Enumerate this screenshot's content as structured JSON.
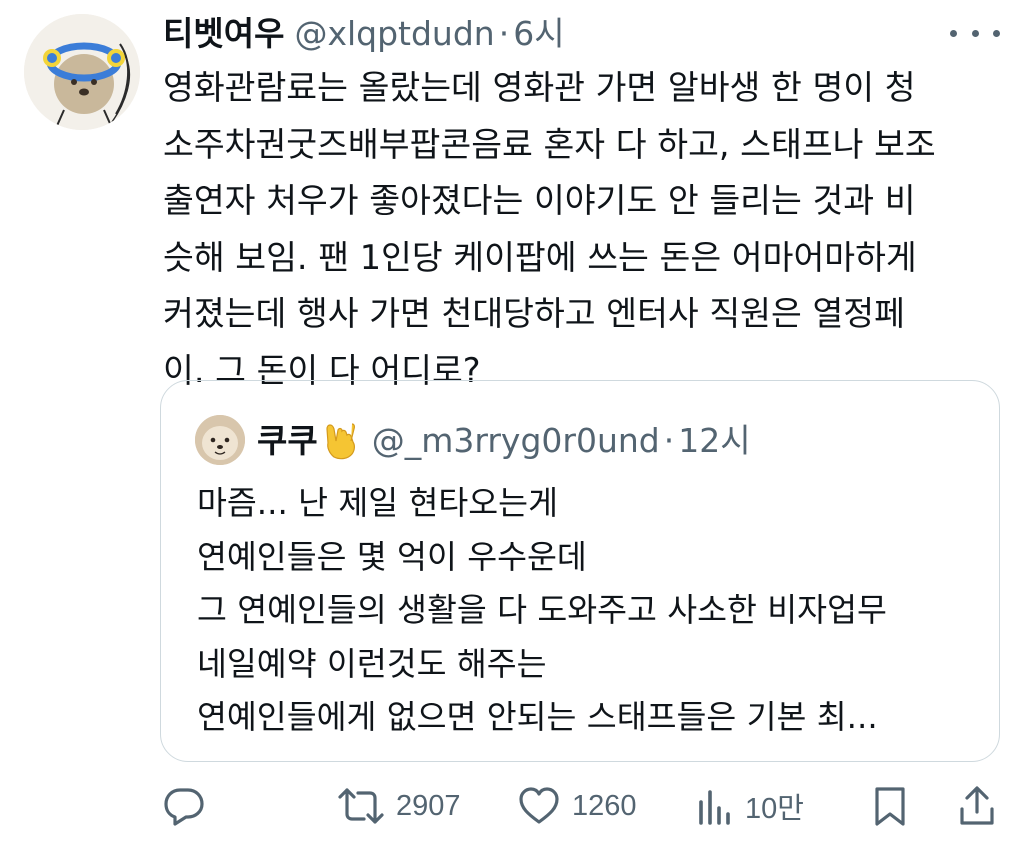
{
  "tweet": {
    "author_name": "티벳여우",
    "author_handle": "@xlqptdudn",
    "separator": "·",
    "time": "6시",
    "lines": [
      "영화관람료는 올랐는데 영화관 가면 알바생 한 명이 청",
      "소주차권굿즈배부팝콘음료 혼자 다 하고, 스태프나 보조",
      "출연자 처우가 좋아졌다는 이야기도 안 들리는 것과 비",
      "슷해 보임. 팬 1인당 케이팝에 쓰는 돈은 어마어마하게",
      "커졌는데 행사 가면 천대당하고 엔터사 직원은 열정페",
      "이. 그 돈이 다 어디로?"
    ]
  },
  "quoted": {
    "author_name": "쿠쿠",
    "author_handle": "@_m3rryg0r0und",
    "separator": "·",
    "time": "12시",
    "lines": [
      "마즘... 난 제일 현타오는게",
      "연예인들은 몇 억이 우수운데",
      "그 연예인들의 생활을 다 도와주고 사소한 비자업무",
      "네일예약 이런것도 해주는",
      "연예인들에게 없으면 안되는 스태프들은 기본 최..."
    ]
  },
  "actions": {
    "retweets": "2907",
    "likes": "1260",
    "views": "10만"
  },
  "icons": [
    "more-icon",
    "reply-icon",
    "retweet-icon",
    "like-icon",
    "views-icon",
    "bookmark-icon",
    "share-icon",
    "rock-on-emoji"
  ],
  "colors": {
    "text": "#0f1419",
    "secondary": "#536471",
    "border": "#cfd9de"
  }
}
